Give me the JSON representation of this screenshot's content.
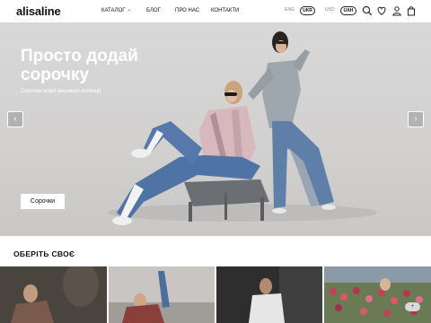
{
  "header": {
    "logo": "alisaline",
    "nav": [
      {
        "label": "КАТАЛОГ",
        "caret": "+"
      },
      {
        "label": "БЛОГ"
      },
      {
        "label": "ПРО НАС"
      },
      {
        "label": "КОНТАКТИ"
      }
    ],
    "lang_inactive": "ENG",
    "lang_active": "UKR",
    "currency_inactive": "USD",
    "currency_active": "UAH",
    "icons": [
      "search-icon",
      "heart-icon",
      "user-icon",
      "bag-icon"
    ]
  },
  "hero": {
    "title_line1": "Просто додай",
    "title_line2": "сорочку",
    "subtitle": "Сорочки нової весняної колекції",
    "cta_label": "Сорочки",
    "prev_arrow": "‹",
    "next_arrow": "›"
  },
  "section": {
    "title": "ОБЕРІТЬ СВОЄ"
  },
  "chat_badge": "+",
  "colors": {
    "hero_bg": "#d4d3d2",
    "text": "#111111",
    "accent": "#e33333",
    "white": "#ffffff"
  }
}
